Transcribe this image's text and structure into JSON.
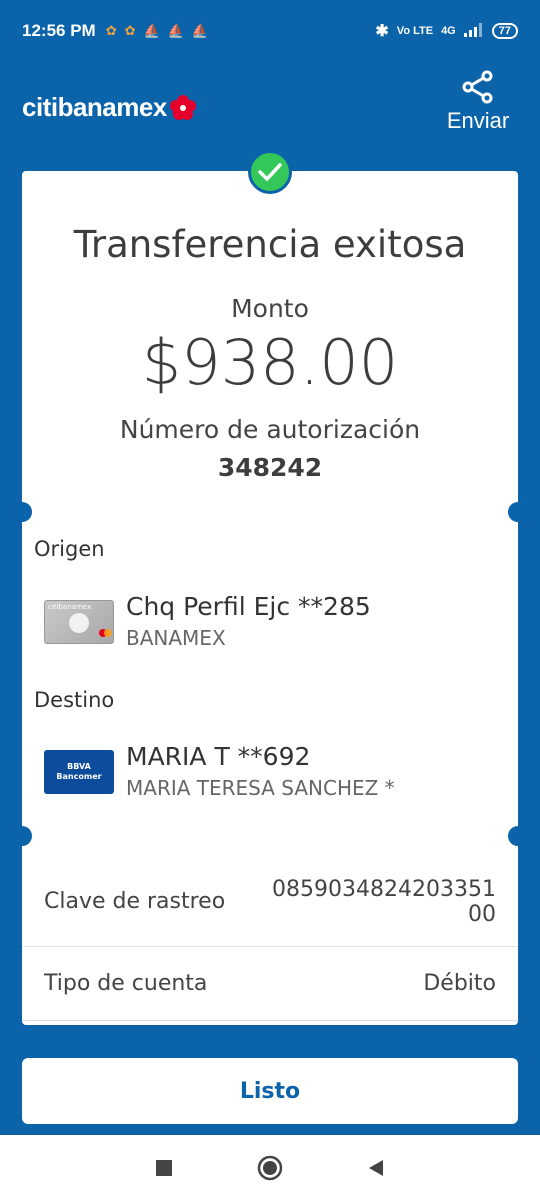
{
  "status_bar": {
    "time": "12:56 PM",
    "network": "Vo LTE",
    "signal_label": "4G",
    "battery": "77"
  },
  "header": {
    "brand": "citibanamex",
    "share_label": "Enviar"
  },
  "receipt": {
    "title": "Transferencia exitosa",
    "amount_label": "Monto",
    "amount": "$938.00",
    "authorization_label": "Número de autorización",
    "authorization_number": "348242",
    "origin": {
      "section_label": "Origen",
      "account_name": "Chq Perfil Ejc **285",
      "bank": "BANAMEX"
    },
    "destination": {
      "section_label": "Destino",
      "account_name": "MARIA T **692",
      "holder": "MARIA TERESA SANCHEZ *",
      "card_brand_line1": "BBVA",
      "card_brand_line2": "Bancomer"
    },
    "details": [
      {
        "label": "Clave de rastreo",
        "value_line1": "0859034824203351",
        "value_line2": "00"
      },
      {
        "label": "Tipo de cuenta",
        "value": "Débito"
      }
    ]
  },
  "actions": {
    "done_label": "Listo"
  },
  "colors": {
    "primary": "#0b63aa",
    "success": "#34c759"
  }
}
